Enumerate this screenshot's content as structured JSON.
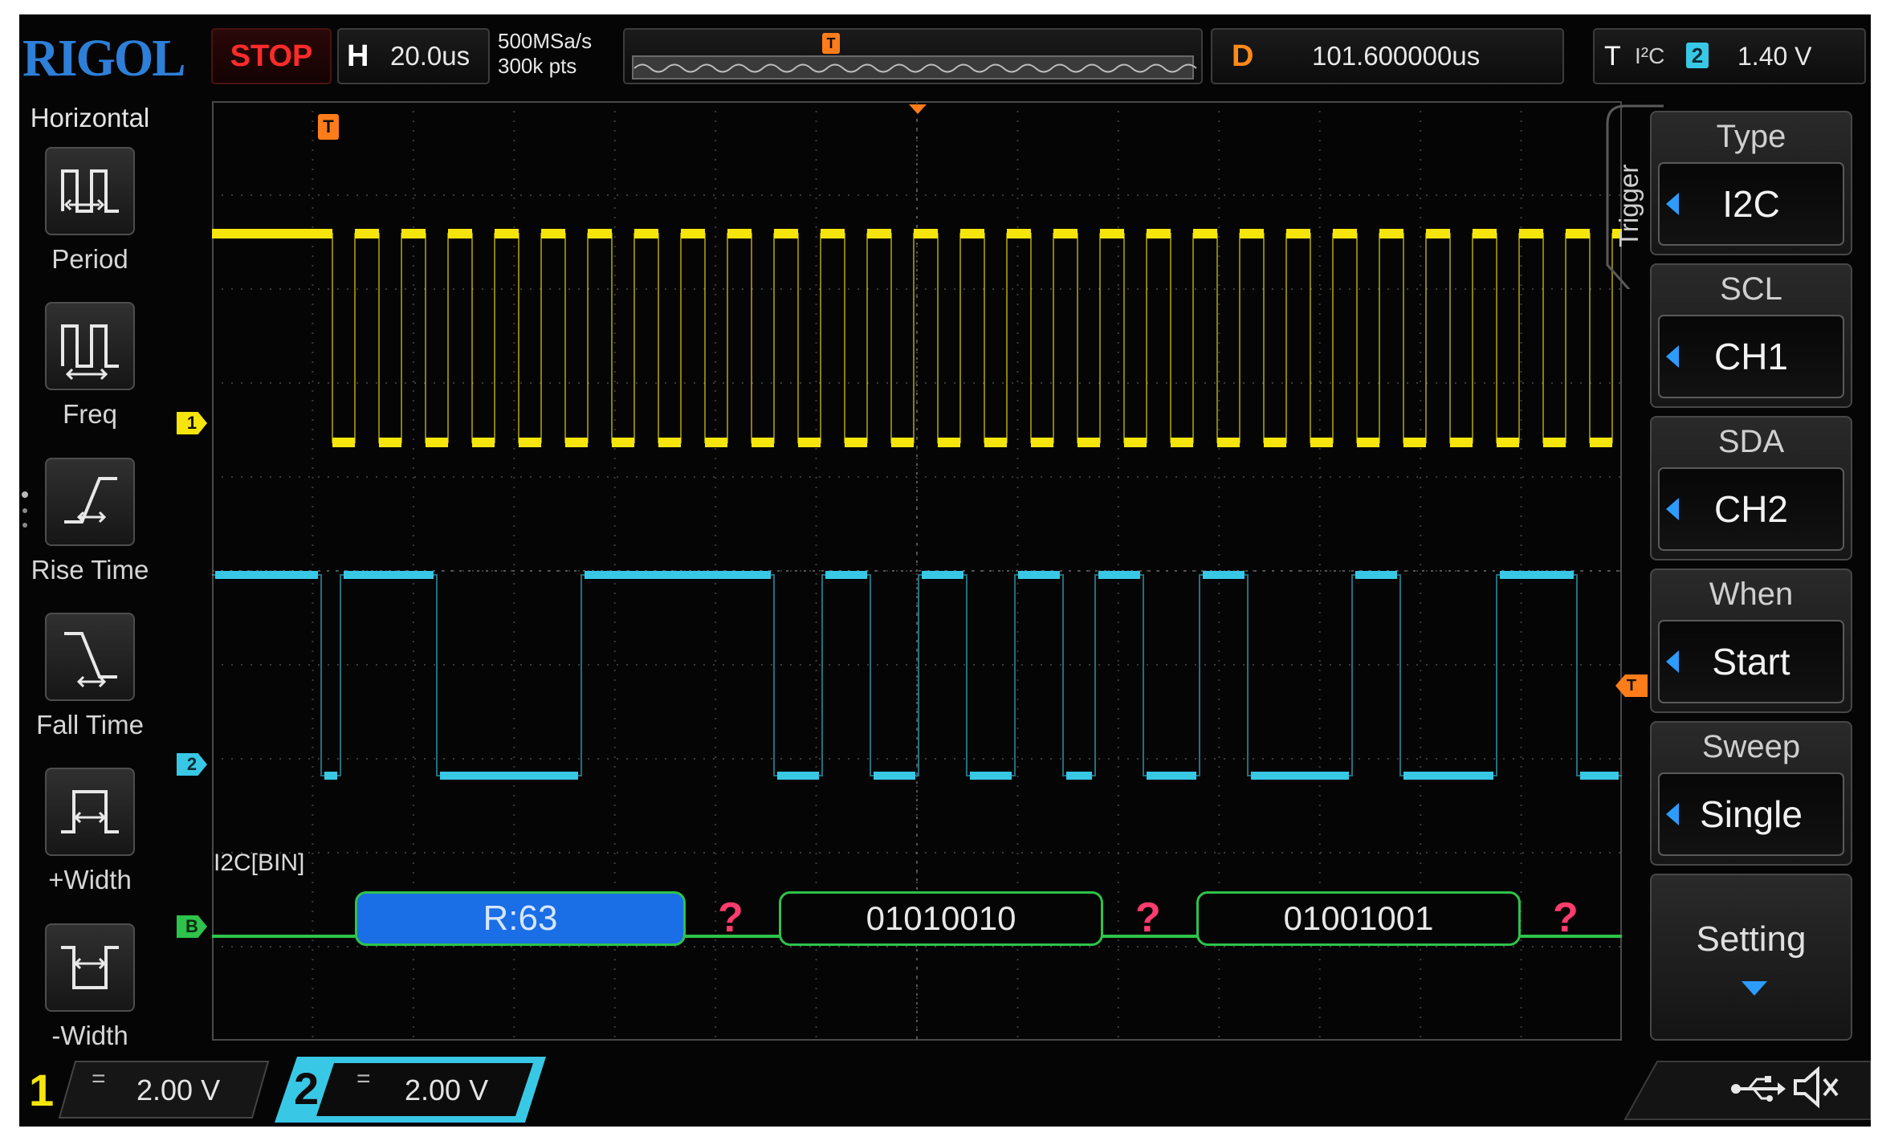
{
  "brand": "RIGOL",
  "status": {
    "run_state": "STOP"
  },
  "horizontal": {
    "letter": "H",
    "timebase": "20.0us",
    "sample_rate": "500MSa/s",
    "memory_depth": "300k pts"
  },
  "delay": {
    "letter": "D",
    "value": "101.600000us"
  },
  "trigger_status": {
    "letter": "T",
    "type": "I²C",
    "source": "2",
    "level": "1.40 V"
  },
  "left_panel": {
    "title": "Horizontal",
    "items": [
      {
        "label": "Period",
        "icon": "period-icon"
      },
      {
        "label": "Freq",
        "icon": "freq-icon"
      },
      {
        "label": "Rise Time",
        "icon": "rise-time-icon"
      },
      {
        "label": "Fall Time",
        "icon": "fall-time-icon"
      },
      {
        "label": "+Width",
        "icon": "positive-width-icon"
      },
      {
        "label": "-Width",
        "icon": "negative-width-icon"
      }
    ]
  },
  "waveform": {
    "ch1_marker": "1",
    "ch2_marker": "2",
    "trigger_marker": "T",
    "bus_marker": "B",
    "decode_label": "I2C[BIN]",
    "decode_packets": [
      {
        "text": "R:63",
        "kind": "address"
      },
      {
        "text": "01010010",
        "kind": "data"
      },
      {
        "text": "01001001",
        "kind": "data"
      }
    ],
    "decode_error_glyph": "?"
  },
  "right_menu": {
    "tab_label": "Trigger",
    "items": [
      {
        "title": "Type",
        "value": "I2C"
      },
      {
        "title": "SCL",
        "value": "CH1"
      },
      {
        "title": "SDA",
        "value": "CH2"
      },
      {
        "title": "When",
        "value": "Start"
      },
      {
        "title": "Sweep",
        "value": "Single"
      }
    ],
    "setting_label": "Setting"
  },
  "channels": [
    {
      "number": "1",
      "coupling": "=",
      "scale": "2.00 V",
      "color": "#f5e50c"
    },
    {
      "number": "2",
      "coupling": "=",
      "scale": "2.00 V",
      "color": "#38c8e6"
    }
  ],
  "status_icons": [
    "usb-icon",
    "sound-muted-icon"
  ],
  "colors": {
    "ch1": "#f5e50c",
    "ch2": "#38c8e6",
    "bus": "#2ec34a",
    "address_fill": "#1a6ee6",
    "error": "#ff3c6e",
    "trigger": "#ff7c1a",
    "brand": "#2d7fd8",
    "stop": "#ff2b2b"
  }
}
